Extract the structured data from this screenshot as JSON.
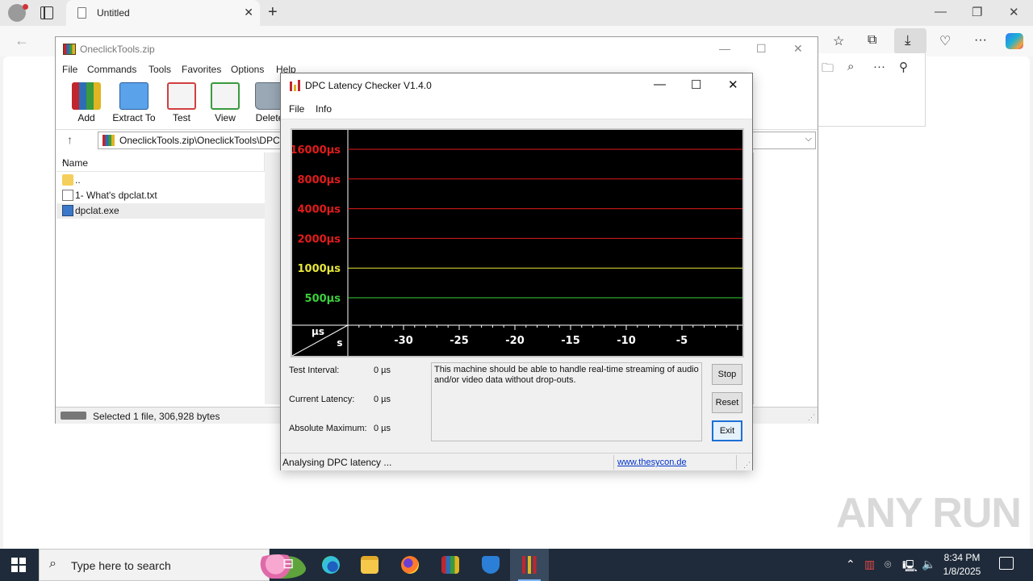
{
  "browser": {
    "tab_title": "Untitled",
    "close_glyph": "✕",
    "new_tab_glyph": "+",
    "window_controls": {
      "minimize": "—",
      "restore": "❐",
      "close": "✕"
    }
  },
  "winrar": {
    "title": "OneclickTools.zip",
    "menu": [
      "File",
      "Commands",
      "Tools",
      "Favorites",
      "Options",
      "Help"
    ],
    "toolbar": [
      {
        "label": "Add",
        "color": "#c0262d"
      },
      {
        "label": "Extract To",
        "color": "#3b82d6"
      },
      {
        "label": "Test",
        "color": "#d04040"
      },
      {
        "label": "View",
        "color": "#3a9a3e"
      },
      {
        "label": "Delete",
        "color": "#7a8a9a"
      }
    ],
    "address": "OneclickTools.zip\\OneclickTools\\DPC",
    "list_header": "Name",
    "files": [
      {
        "name": "..",
        "icon": "folder-icon",
        "selected": false
      },
      {
        "name": "1- What's dpclat.txt",
        "icon": "text-file-icon",
        "selected": false
      },
      {
        "name": "dpclat.exe",
        "icon": "exe-file-icon",
        "selected": true
      }
    ],
    "status": "Selected 1 file, 306,928 bytes"
  },
  "dpc": {
    "title": "DPC Latency Checker V1.4.0",
    "menu": [
      "File",
      "Info"
    ],
    "chart_data": {
      "type": "line",
      "title": "",
      "xlabel": "s",
      "ylabel": "µs",
      "y_scale": "log",
      "y_reference_lines": [
        {
          "label": "16000µs",
          "value": 16000,
          "color": "#e21b1b"
        },
        {
          "label": "8000µs",
          "value": 8000,
          "color": "#e21b1b"
        },
        {
          "label": "4000µs",
          "value": 4000,
          "color": "#e21b1b"
        },
        {
          "label": "2000µs",
          "value": 2000,
          "color": "#e21b1b"
        },
        {
          "label": "1000µs",
          "value": 1000,
          "color": "#e6e63a"
        },
        {
          "label": "500µs",
          "value": 500,
          "color": "#3ad03a"
        }
      ],
      "x_ticks": [
        "-30",
        "-25",
        "-20",
        "-15",
        "-10",
        "-5"
      ],
      "series": []
    },
    "info": {
      "test_interval_label": "Test Interval:",
      "test_interval_value": "0 µs",
      "current_latency_label": "Current Latency:",
      "current_latency_value": "0 µs",
      "absolute_maximum_label": "Absolute Maximum:",
      "absolute_maximum_value": "0 µs"
    },
    "message": "This machine should be able to handle real-time streaming of audio and/or video data without drop-outs.",
    "buttons": {
      "stop": "Stop",
      "reset": "Reset",
      "exit": "Exit"
    },
    "status": "Analysing DPC latency ...",
    "link": "www.thesycon.de"
  },
  "taskbar": {
    "search_placeholder": "Type here to search",
    "time": "8:34 PM",
    "date": "1/8/2025"
  },
  "watermark": "ANY RUN"
}
